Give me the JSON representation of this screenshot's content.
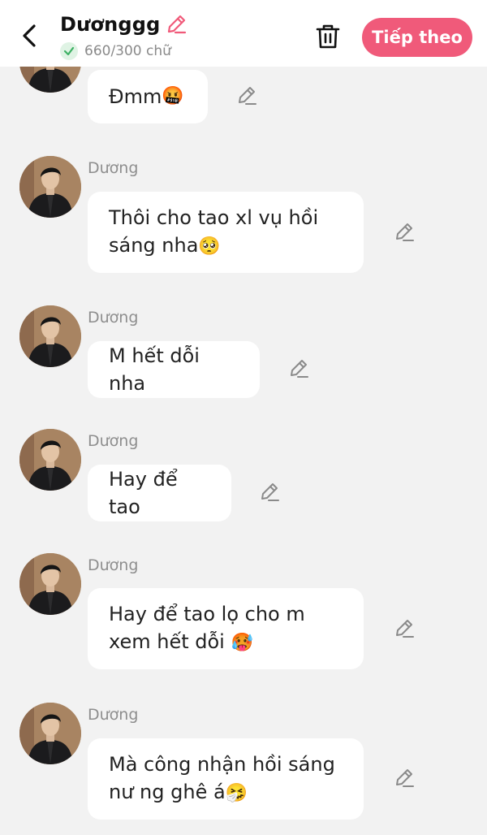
{
  "header": {
    "title": "Dươnggg",
    "count": "660/300 chữ",
    "next_label": "Tiếp theo"
  },
  "messages": [
    {
      "sender": "",
      "text": "Đmm",
      "emoji": "🤬"
    },
    {
      "sender": "Dương",
      "text": "Thôi cho tao xl vụ hồi sáng nha",
      "emoji": "🥺"
    },
    {
      "sender": "Dương",
      "text": "M hết dỗi nha",
      "emoji": ""
    },
    {
      "sender": "Dương",
      "text": "Hay để tao",
      "emoji": ""
    },
    {
      "sender": "Dương",
      "text": "Hay để tao lọ cho m xem hết dỗi ",
      "emoji": "🥵"
    },
    {
      "sender": "Dương",
      "text": "Mà công nhận hồi sáng nư ng ghê á",
      "emoji": "🤧"
    }
  ],
  "colors": {
    "accent": "#f05a7a",
    "background": "#f2f2f2",
    "bubble": "#ffffff"
  }
}
